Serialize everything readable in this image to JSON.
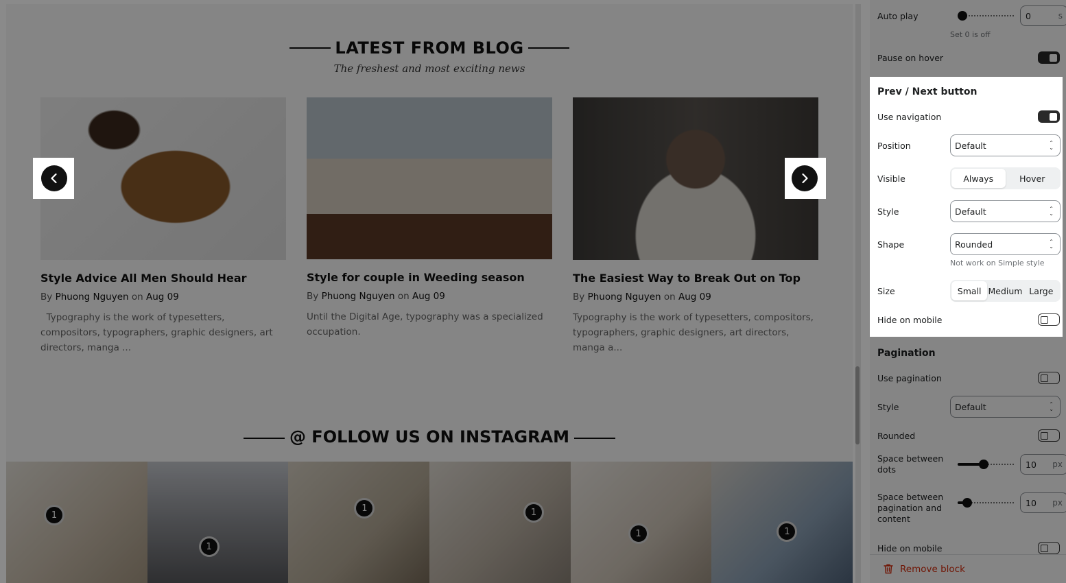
{
  "blog": {
    "title": "LATEST FROM BLOG",
    "subtitle": "The freshest and most exciting news",
    "posts": [
      {
        "title": "Style Advice All Men Should Hear",
        "by": "By",
        "author": "Phuong Nguyen",
        "on": "on",
        "date": "Aug 09",
        "excerpt": "  Typography is the work of typesetters, compositors, typographers, graphic designers, art directors, manga ..."
      },
      {
        "title": "Style for couple in Weeding season",
        "by": "By",
        "author": "Phuong Nguyen",
        "on": "on",
        "date": "Aug 09",
        "excerpt": "Until the Digital Age, typography was a specialized occupation."
      },
      {
        "title": "The Easiest Way to Break Out on Top",
        "by": "By",
        "author": "Phuong Nguyen",
        "on": "on",
        "date": "Aug 09",
        "excerpt": "Typography is the work of typesetters, compositors, typographers, graphic designers, art directors, manga a..."
      }
    ],
    "prev_icon": "chevron-left-icon",
    "next_icon": "chevron-right-icon"
  },
  "instagram": {
    "title": "@ FOLLOW US ON INSTAGRAM",
    "pins": [
      "1",
      "1",
      "1",
      "1",
      "1",
      "1"
    ]
  },
  "panel": {
    "autoplay": {
      "label": "Auto play",
      "value": "0",
      "unit": "s",
      "hint": "Set 0 is off"
    },
    "pause_on_hover": {
      "label": "Pause on hover",
      "on": true
    },
    "nav": {
      "title": "Prev / Next button",
      "use_navigation": {
        "label": "Use navigation",
        "on": true
      },
      "position": {
        "label": "Position",
        "value": "Default"
      },
      "visible": {
        "label": "Visible",
        "options": [
          "Always",
          "Hover"
        ],
        "selected": "Always"
      },
      "style": {
        "label": "Style",
        "value": "Default"
      },
      "shape": {
        "label": "Shape",
        "value": "Rounded",
        "hint": "Not work on Simple style"
      },
      "size": {
        "label": "Size",
        "options": [
          "Small",
          "Medium",
          "Large"
        ],
        "selected": "Small"
      },
      "hide_on_mobile": {
        "label": "Hide on mobile",
        "on": false
      }
    },
    "pagination": {
      "title": "Pagination",
      "use_pagination": {
        "label": "Use pagination",
        "on": false
      },
      "style": {
        "label": "Style",
        "value": "Default"
      },
      "rounded": {
        "label": "Rounded",
        "on": false
      },
      "space_dots": {
        "label": "Space between dots",
        "value": "10",
        "unit": "px"
      },
      "space_content": {
        "label": "Space between pagination and content",
        "value": "10",
        "unit": "px"
      },
      "hide_on_mobile": {
        "label": "Hide on mobile",
        "on": false
      }
    },
    "remove_block": {
      "label": "Remove block",
      "icon": "trash-icon",
      "color": "#d72c0d"
    }
  }
}
